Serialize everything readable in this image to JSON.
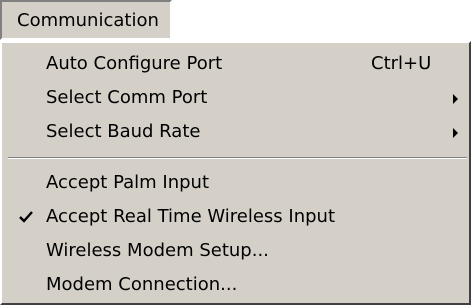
{
  "menubar": {
    "title": "Communication"
  },
  "menu": {
    "items": [
      {
        "label": "Auto Configure Port",
        "shortcut": "Ctrl+U"
      },
      {
        "label": "Select Comm Port",
        "submenu": true
      },
      {
        "label": "Select Baud Rate",
        "submenu": true
      },
      {
        "label": "Accept Palm Input"
      },
      {
        "label": "Accept Real Time Wireless Input",
        "checked": true
      },
      {
        "label": "Wireless Modem Setup..."
      },
      {
        "label": "Modem Connection..."
      }
    ]
  },
  "colors": {
    "menu_face": "#d4d0c8",
    "shadow": "#808080",
    "highlight": "#ffffff",
    "dark_shadow": "#404040",
    "text": "#000000"
  },
  "icons": {
    "submenu_arrow": "chevron-right-icon",
    "checked": "check-icon"
  }
}
